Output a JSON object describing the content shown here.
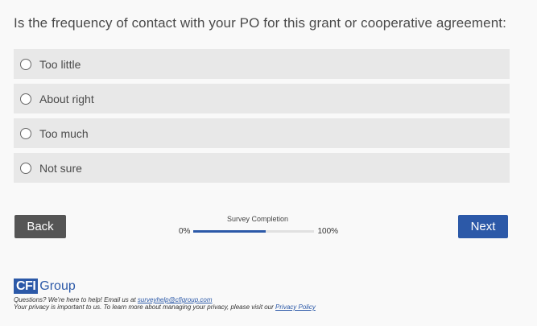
{
  "question": "Is the frequency of contact with your PO for this grant or cooperative agreement:",
  "options": [
    {
      "label": "Too little"
    },
    {
      "label": "About right"
    },
    {
      "label": "Too much"
    },
    {
      "label": "Not sure"
    }
  ],
  "nav": {
    "back_label": "Back",
    "next_label": "Next"
  },
  "progress": {
    "title": "Survey Completion",
    "start_label": "0%",
    "end_label": "100%",
    "fraction": 0.6
  },
  "footer": {
    "logo_cfi": "CFI",
    "logo_group": "Group",
    "help_prefix": "Questions? We're here to help! Email us at ",
    "help_email": "surveyhelp@cfigroup.com",
    "privacy_prefix": "Your privacy is important to us. To learn more about managing your privacy, please visit our ",
    "privacy_link": "Privacy Policy"
  },
  "colors": {
    "accent": "#2c59a8",
    "back_button": "#555555",
    "option_bg": "#e8e8e8"
  }
}
